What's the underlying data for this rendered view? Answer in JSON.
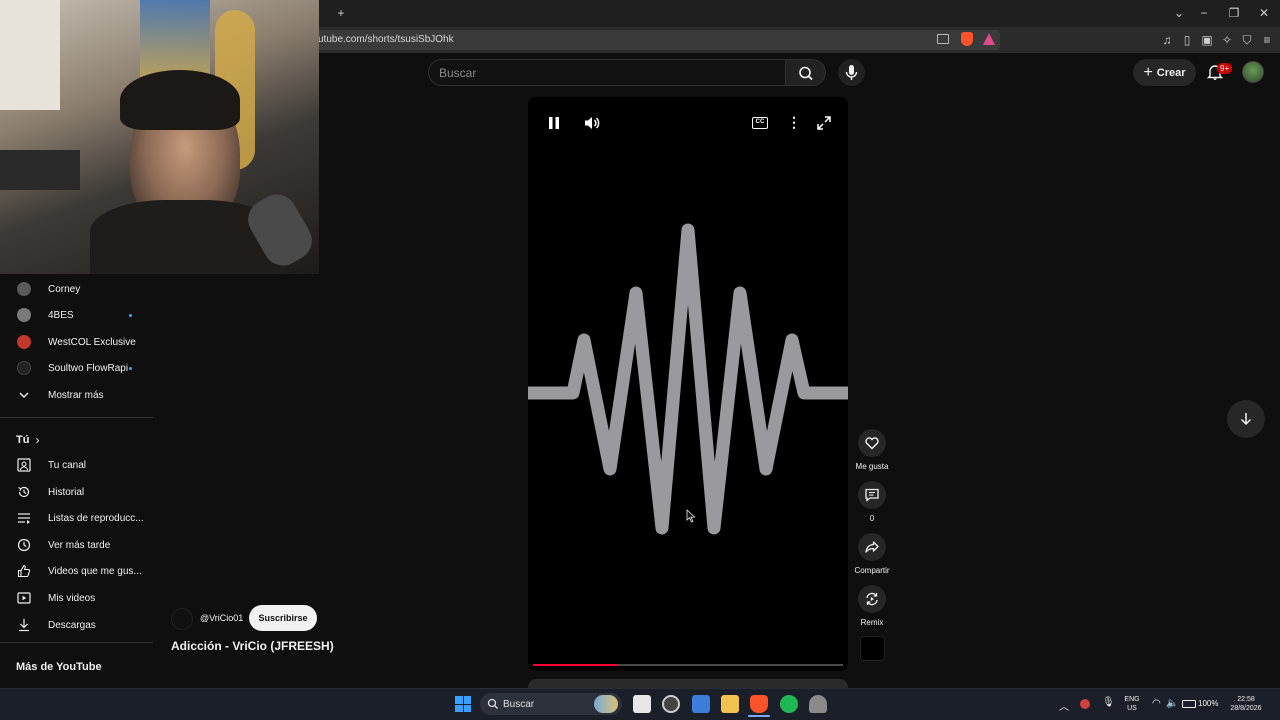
{
  "browser": {
    "url": "utube.com/shorts/tsusiSbJOhk",
    "new_tab_symbol": "+"
  },
  "header": {
    "search_placeholder": "Buscar",
    "create_label": "Crear",
    "notifications_count": "9+"
  },
  "sidebar": {
    "channels": [
      {
        "label": "Corney",
        "color": "#5a5a5a",
        "new": false
      },
      {
        "label": "4BES",
        "color": "#7a7a7a",
        "new": true
      },
      {
        "label": "WestCOL Exclusive",
        "color": "#c0392b",
        "new": false
      },
      {
        "label": "Soultwo FlowRapi",
        "color": "#222222",
        "new": true
      }
    ],
    "show_more": "Mostrar más",
    "you_heading": "Tú",
    "you_items": [
      {
        "label": "Tu canal",
        "icon": "channel-icon"
      },
      {
        "label": "Historial",
        "icon": "history-icon"
      },
      {
        "label": "Listas de reproducc...",
        "icon": "playlists-icon"
      },
      {
        "label": "Ver más tarde",
        "icon": "watch-later-icon"
      },
      {
        "label": "Videos que me gus...",
        "icon": "liked-icon"
      },
      {
        "label": "Mis videos",
        "icon": "my-videos-icon"
      },
      {
        "label": "Descargas",
        "icon": "downloads-icon"
      }
    ],
    "more_heading": "Más de YouTube"
  },
  "player": {
    "progress": 0.27,
    "accent": "#ff0033"
  },
  "actions": {
    "like_label": "Me gusta",
    "comments_count": "0",
    "share_label": "Compartir",
    "remix_label": "Remix"
  },
  "channel": {
    "handle": "@VriCio01",
    "subscribe_label": "Suscribirse",
    "video_title": "Adicción - VriCio (JFREESH)"
  },
  "taskbar": {
    "search_label": "Buscar",
    "lang_top": "ENG",
    "lang_bottom": "US",
    "battery": "100%",
    "time": "22:58",
    "date": "28/8/2026"
  }
}
